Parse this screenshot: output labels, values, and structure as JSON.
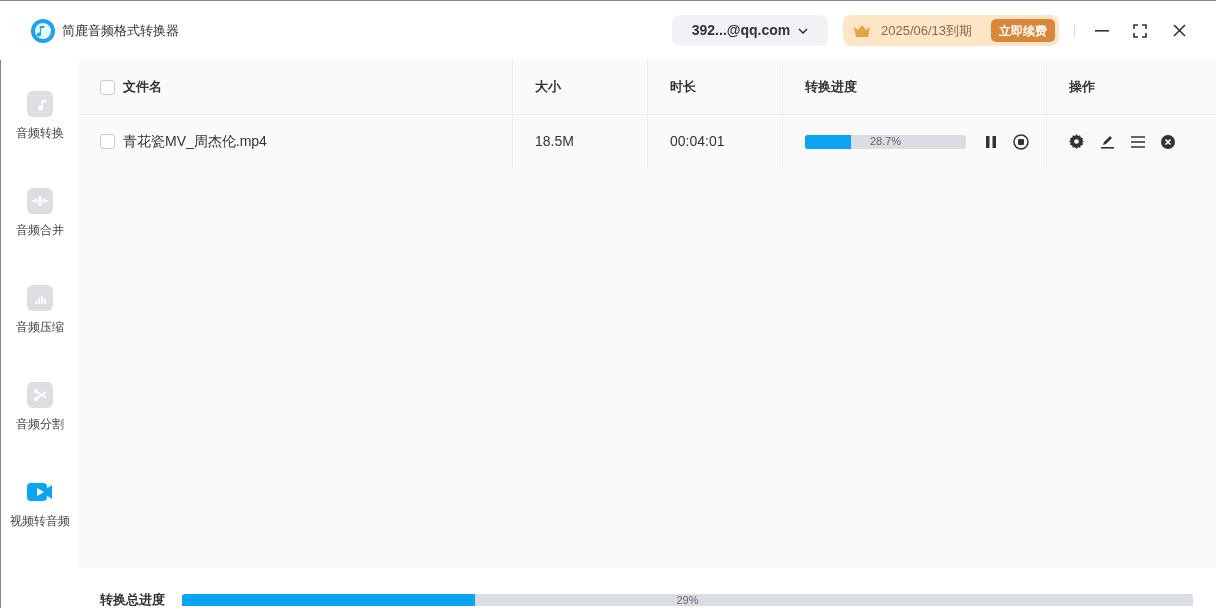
{
  "window": {
    "title": "简鹿音频格式转换器"
  },
  "account": {
    "label": "392...@qq.com"
  },
  "membership": {
    "expiry": "2025/06/13到期",
    "renew_button": "立即续费"
  },
  "sidebar": {
    "items": [
      {
        "label": "音频转换",
        "selected": false
      },
      {
        "label": "音频合并",
        "selected": false
      },
      {
        "label": "音频压缩",
        "selected": false
      },
      {
        "label": "音频分割",
        "selected": false
      },
      {
        "label": "视频转音频",
        "selected": true
      }
    ]
  },
  "table": {
    "select_all_checked": false,
    "columns": [
      "文件名",
      "大小",
      "时长",
      "转换进度",
      "操作"
    ],
    "rows": [
      {
        "checked": false,
        "name": "青花瓷MV_周杰伦.mp4",
        "size": "18.5M",
        "duration": "00:04:01",
        "level": 0.287,
        "progress": "28.7%"
      }
    ]
  },
  "total_progress": {
    "label": "转换总进度",
    "level": 0.29,
    "reading": "29%"
  }
}
